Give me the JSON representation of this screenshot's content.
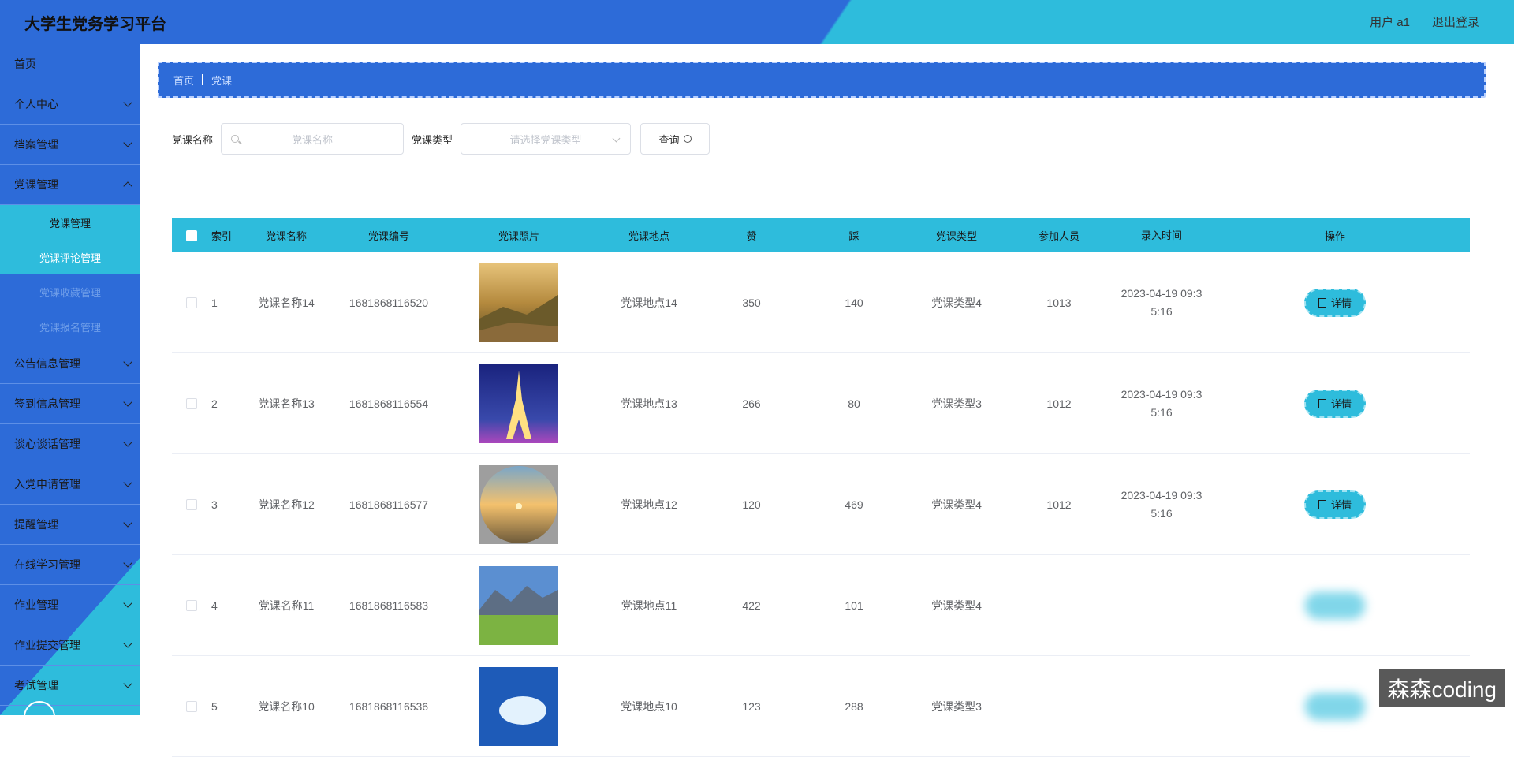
{
  "app": {
    "title": "大学生党务学习平台",
    "user_label": "用户 a1",
    "logout_label": "退出登录"
  },
  "sidebar": {
    "home": "首页",
    "items": [
      "个人中心",
      "档案管理",
      "党课管理"
    ],
    "submenu": [
      "党课管理",
      "党课评论管理",
      "党课收藏管理",
      "党课报名管理"
    ],
    "items_after": [
      "公告信息管理",
      "签到信息管理",
      "谈心谈话管理",
      "入党申请管理",
      "提醒管理",
      "在线学习管理",
      "作业管理",
      "作业提交管理",
      "考试管理"
    ]
  },
  "breadcrumb": {
    "home": "首页",
    "current": "党课"
  },
  "search": {
    "name_label": "党课名称",
    "name_placeholder": "党课名称",
    "type_label": "党课类型",
    "type_placeholder": "请选择党课类型",
    "query_label": "查询"
  },
  "table": {
    "headers": [
      "索引",
      "党课名称",
      "党课编号",
      "党课照片",
      "党课地点",
      "赞",
      "踩",
      "党课类型",
      "参加人员",
      "录入时间",
      "操作"
    ],
    "detail_label": "详情",
    "rows": [
      {
        "index": "1",
        "name": "党课名称14",
        "code": "1681868116520",
        "location": "党课地点14",
        "likes": "350",
        "dislikes": "140",
        "type": "党课类型4",
        "participants": "1013",
        "time_line1": "2023-04-19 09:3",
        "time_line2": "5:16",
        "photo": "mountain-sunset"
      },
      {
        "index": "2",
        "name": "党课名称13",
        "code": "1681868116554",
        "location": "党课地点13",
        "likes": "266",
        "dislikes": "80",
        "type": "党课类型3",
        "participants": "1012",
        "time_line1": "2023-04-19 09:3",
        "time_line2": "5:16",
        "photo": "eiffel-tower"
      },
      {
        "index": "3",
        "name": "党课名称12",
        "code": "1681868116577",
        "location": "党课地点12",
        "likes": "120",
        "dislikes": "469",
        "type": "党课类型4",
        "participants": "1012",
        "time_line1": "2023-04-19 09:3",
        "time_line2": "5:16",
        "photo": "sunset-globe"
      },
      {
        "index": "4",
        "name": "党课名称11",
        "code": "1681868116583",
        "location": "党课地点11",
        "likes": "422",
        "dislikes": "101",
        "type": "党课类型4",
        "participants": "",
        "time_line1": "",
        "time_line2": "",
        "photo": "green-valley"
      },
      {
        "index": "5",
        "name": "党课名称10",
        "code": "1681868116536",
        "location": "党课地点10",
        "likes": "123",
        "dislikes": "288",
        "type": "党课类型3",
        "participants": "",
        "time_line1": "",
        "time_line2": "",
        "photo": "blue-sky"
      }
    ]
  },
  "watermark": "森森coding",
  "colors": {
    "primary_blue": "#2d6bd8",
    "accent_cyan": "#2ebcdc"
  }
}
